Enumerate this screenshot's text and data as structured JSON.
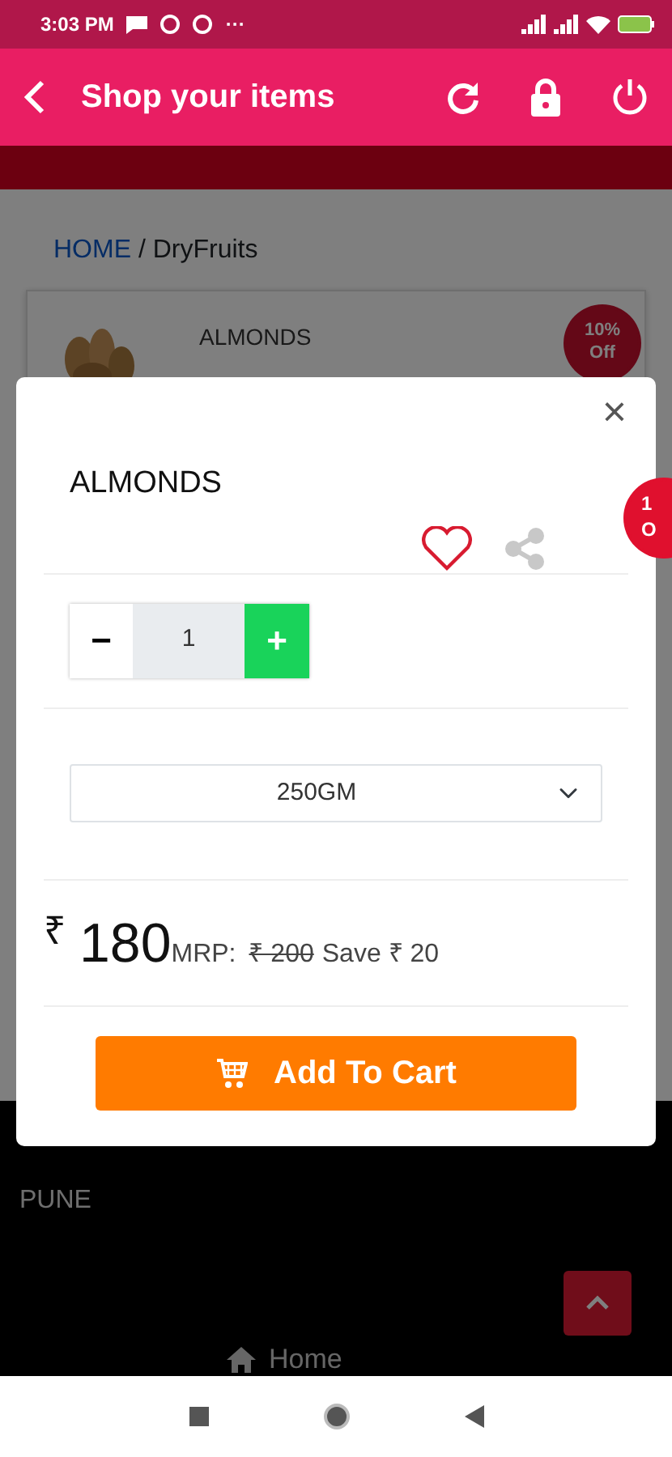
{
  "status_bar": {
    "time": "3:03 PM",
    "more": "···"
  },
  "app_bar": {
    "title": "Shop your items"
  },
  "breadcrumb": {
    "home": "HOME",
    "separator": "/",
    "current": "DryFruits"
  },
  "product_card": {
    "name": "ALMONDS",
    "badge": [
      "10%",
      "Off"
    ]
  },
  "modal": {
    "close": "×",
    "title": "ALMONDS",
    "favorite": false,
    "decrease": "−",
    "quantity": "1",
    "increase": "+",
    "variant": "250GM",
    "currency": "₹",
    "price": "180",
    "mrp_label": "MRP:",
    "mrp": "₹ 200",
    "save": "Save ₹ 20",
    "add_button": "Add To Cart"
  },
  "side_badge": [
    "1",
    "O"
  ],
  "footer": {
    "city": "PUNE",
    "nav": "Home"
  }
}
